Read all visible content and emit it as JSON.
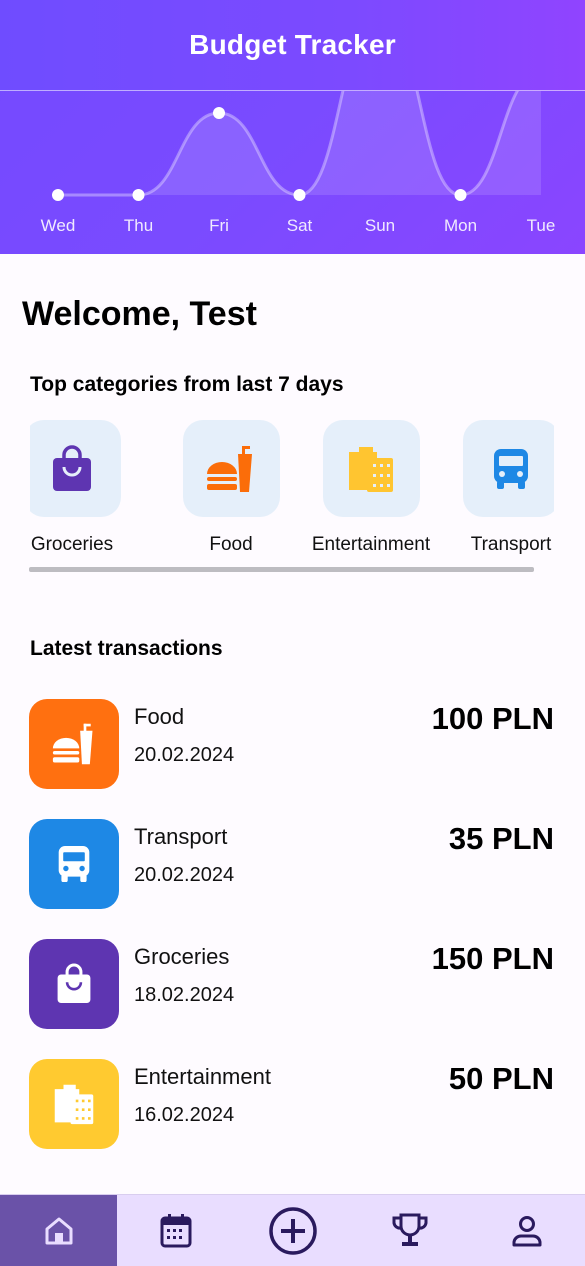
{
  "app": {
    "title": "Budget Tracker"
  },
  "chart_data": {
    "type": "line",
    "categories": [
      "Wed",
      "Thu",
      "Fri",
      "Sat",
      "Sun",
      "Mon",
      "Tue"
    ],
    "values": [
      0,
      0,
      100,
      0,
      220,
      0,
      150
    ],
    "ylim": [
      0,
      100
    ],
    "grid": false
  },
  "welcome": "Welcome, Test",
  "categories_section": {
    "title": "Top categories from last 7 days",
    "items": [
      {
        "label": "Groceries",
        "icon": "shopping-bag-icon",
        "color": "#5e35b1"
      },
      {
        "label": "Food",
        "icon": "fastfood-icon",
        "color": "#fb6d09"
      },
      {
        "label": "Entertainment",
        "icon": "film-icon",
        "color": "#ffc530"
      },
      {
        "label": "Transport",
        "icon": "bus-icon",
        "color": "#1e88e5"
      }
    ]
  },
  "transactions_section": {
    "title": "Latest transactions",
    "items": [
      {
        "name": "Food",
        "date": "20.02.2024",
        "amount": "100 PLN",
        "icon": "fastfood-icon",
        "color": "#ff7010"
      },
      {
        "name": "Transport",
        "date": "20.02.2024",
        "amount": "35 PLN",
        "icon": "bus-icon",
        "color": "#1e88e5"
      },
      {
        "name": "Groceries",
        "date": "18.02.2024",
        "amount": "150 PLN",
        "icon": "shopping-bag-icon",
        "color": "#5e35b1"
      },
      {
        "name": "Entertainment",
        "date": "16.02.2024",
        "amount": "50 PLN",
        "icon": "film-icon",
        "color": "#ffca30"
      }
    ]
  },
  "nav": {
    "items": [
      {
        "icon": "home-icon",
        "active": true
      },
      {
        "icon": "calendar-icon",
        "active": false
      },
      {
        "icon": "add-circle-icon",
        "active": false
      },
      {
        "icon": "trophy-icon",
        "active": false
      },
      {
        "icon": "person-icon",
        "active": false
      }
    ],
    "active_bg": "#6a52a8",
    "bar_bg": "#e9ddff"
  }
}
